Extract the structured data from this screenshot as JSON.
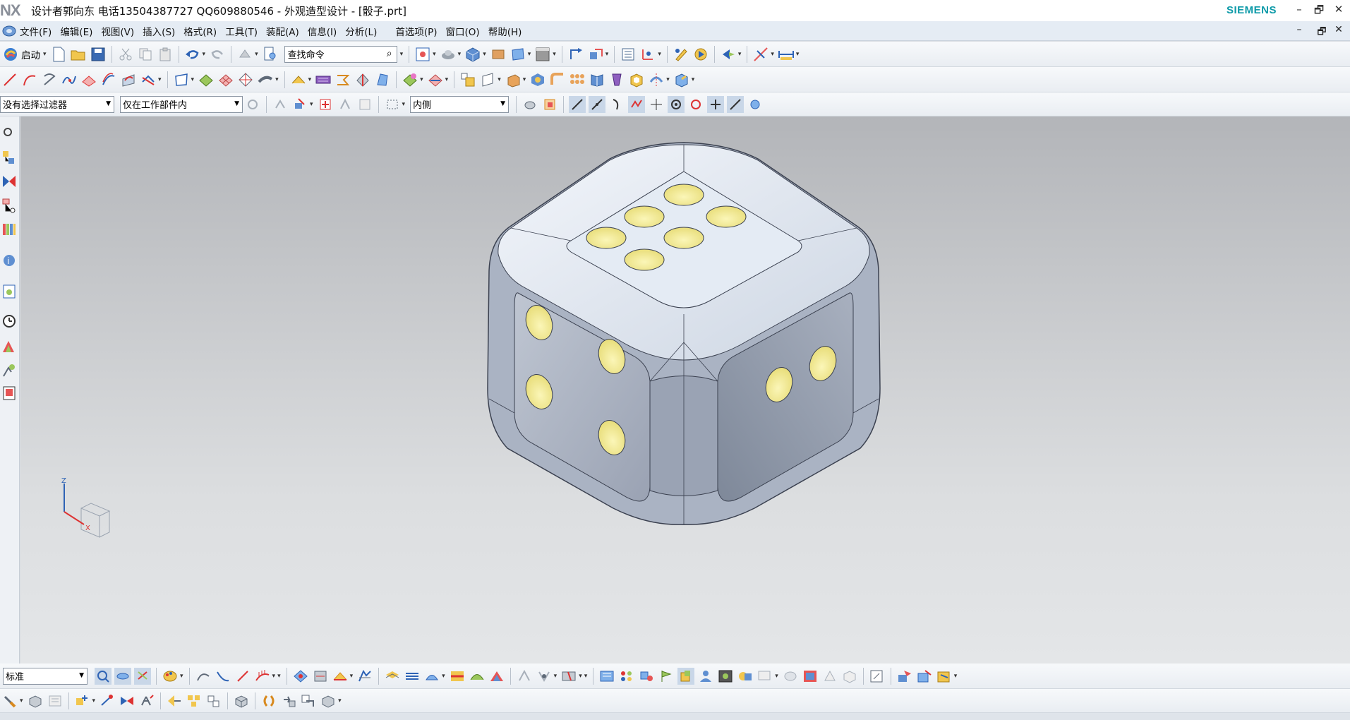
{
  "titlebar": {
    "logo": "NX",
    "title": "设计者郭向东  电话13504387727  QQ609880546 - 外观造型设计 - [骰子.prt]",
    "brand": "SIEMENS",
    "controls": {
      "minimize": "–",
      "restore": "🗗",
      "close": "✕"
    }
  },
  "menu": {
    "items": [
      "文件(F)",
      "编辑(E)",
      "视图(V)",
      "插入(S)",
      "格式(R)",
      "工具(T)",
      "装配(A)",
      "信息(I)",
      "分析(L)",
      "首选项(P)",
      "窗口(O)",
      "帮助(H)"
    ],
    "mdi_controls": {
      "minimize": "–",
      "restore": "🗗",
      "close": "✕"
    }
  },
  "toolbar1": {
    "start_label": "启动",
    "search_placeholder": "查找命令"
  },
  "selection_bar": {
    "filter_value": "没有选择过滤器",
    "scope_value": "仅在工作部件内",
    "mode_value": "内侧"
  },
  "bottom_toolbar": {
    "view_style_value": "标准"
  },
  "triad": {
    "z_label": "Z",
    "x_label": "X"
  },
  "colors": {
    "pip_fill": "#f3ec9c",
    "die_top": "#dfe9f5",
    "die_left": "#a9b2c3",
    "die_right": "#8f99aa",
    "brand": "#0d9aa8"
  }
}
